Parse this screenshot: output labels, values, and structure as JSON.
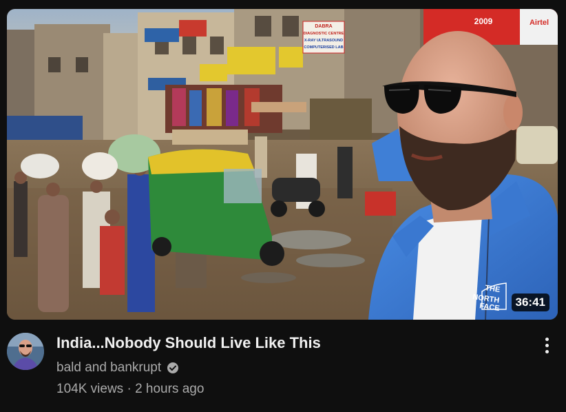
{
  "video": {
    "duration": "36:41",
    "title": "India...Nobody Should Live Like This",
    "channel": "bald and bankrupt",
    "views": "104K views",
    "separator": "·",
    "age": "2 hours ago"
  },
  "signs": {
    "dabra_line1": "DABRA",
    "dabra_line2": "DIAGNOSTIC CENTRE",
    "dabra_line3": "X-RAY ULTRASOUND",
    "dabra_line4": "COMPUTERISED LAB",
    "year": "2009",
    "brand": "Airtel",
    "jacket_line1": "THE",
    "jacket_line2": "NORTH",
    "jacket_line3": "FACE"
  },
  "icons": {
    "verified": "verified-check-icon",
    "menu": "more-vert-icon"
  },
  "colors": {
    "background": "#0f0f0f",
    "title": "#f1f1f1",
    "secondary_text": "#aaaaaa",
    "jacket": "#3f7fd6",
    "rickshaw_green": "#2e8a3a",
    "rickshaw_yellow": "#e2c22a"
  }
}
